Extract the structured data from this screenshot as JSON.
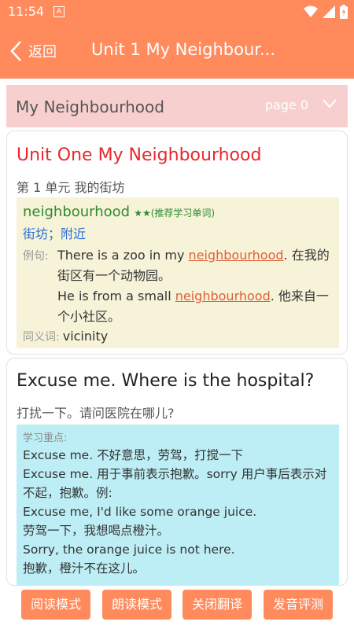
{
  "status_bar": {
    "time": "11:54",
    "notification_icon": "A"
  },
  "app_bar": {
    "back_label": "返回",
    "title": "Unit 1 My Neighbour..."
  },
  "section_header": {
    "title": "My Neighbourhood",
    "page_label": "page 0"
  },
  "unit_card": {
    "title": "Unit One My Neighbourhood",
    "subtitle": "第 1 单元 我的街坊",
    "vocab": {
      "word": "neighbourhood",
      "stars": "★★(推荐学习单词)",
      "meaning": "街坊；附近",
      "example_label": "例句:",
      "examples": [
        {
          "before": "There is a zoo in my ",
          "highlight": "neighbourhood",
          "after": ". 在我的街区有一个动物园。"
        },
        {
          "before": "He is from a small ",
          "highlight": "neighbourhood",
          "after": ". 他来自一个小社区。"
        }
      ],
      "synonym_label": "同义词:",
      "synonym": "vicinity"
    }
  },
  "sentence_card": {
    "english": "Excuse me. Where is the hospital?",
    "chinese": "打扰一下。请问医院在哪儿?",
    "study_label": "学习重点:",
    "study_lines": [
      "Excuse me. 不好意思，劳驾，打搅一下",
      "Excuse me. 用于事前表示抱歉。sorry 用户事后表示对不起，抱歉。例:",
      "Excuse me, I'd like some orange juice.",
      "劳驾一下，我想喝点橙汁。",
      "Sorry, the orange juice is not here.",
      "抱歉，橙汁不在这儿。"
    ]
  },
  "bottom_buttons": {
    "reading_mode": "阅读模式",
    "read_aloud_mode": "朗读模式",
    "close_translation": "关闭翻译",
    "pronunciation_eval": "发音评测"
  },
  "colors": {
    "accent": "#ff8a5c",
    "header_pink": "#f8cfcf",
    "title_red": "#e8282c",
    "vocab_bg": "#f7f3d9",
    "study_bg": "#bdeef5"
  }
}
